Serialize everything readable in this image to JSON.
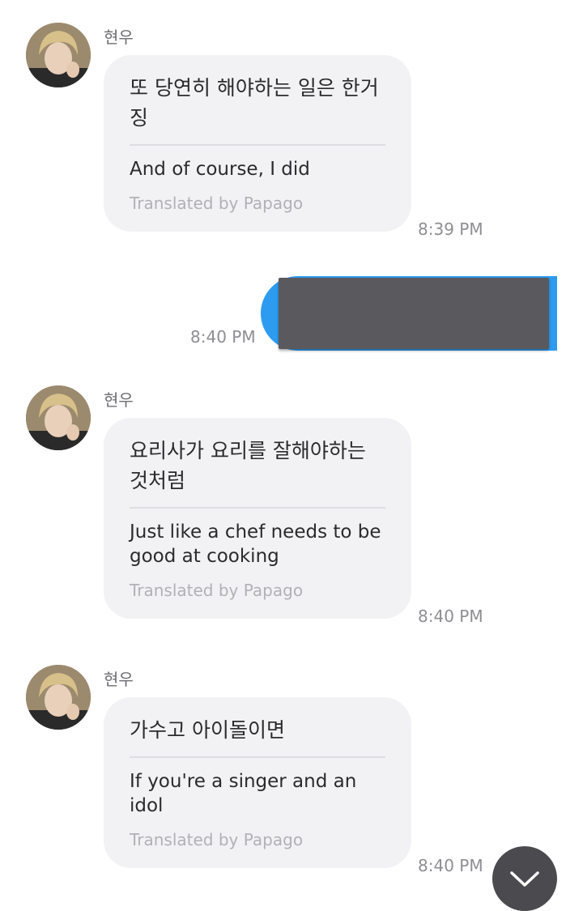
{
  "messages": [
    {
      "sender": "현우",
      "original": "또 당연히 해야하는 일은 한거징",
      "translation": "And of course, I did",
      "credit": "Translated by Papago",
      "time": "8:39 PM"
    },
    {
      "outgoing_time": "8:40 PM"
    },
    {
      "sender": "현우",
      "original": "요리사가 요리를 잘해야하는 것처럼",
      "translation": "Just like a chef needs to be good at cooking",
      "credit": "Translated by Papago",
      "time": "8:40 PM"
    },
    {
      "sender": "현우",
      "original": "가수고 아이돌이면",
      "translation": "If you're a singer and an idol",
      "credit": "Translated by Papago",
      "time": "8:40 PM"
    }
  ],
  "colors": {
    "outgoing_bubble": "#2d9cf0",
    "incoming_bubble": "#f2f2f4",
    "redaction": "#5a5a5e",
    "scroll_button": "#4a4a4f"
  },
  "icons": {
    "scroll_button": "chevron-down-icon"
  }
}
